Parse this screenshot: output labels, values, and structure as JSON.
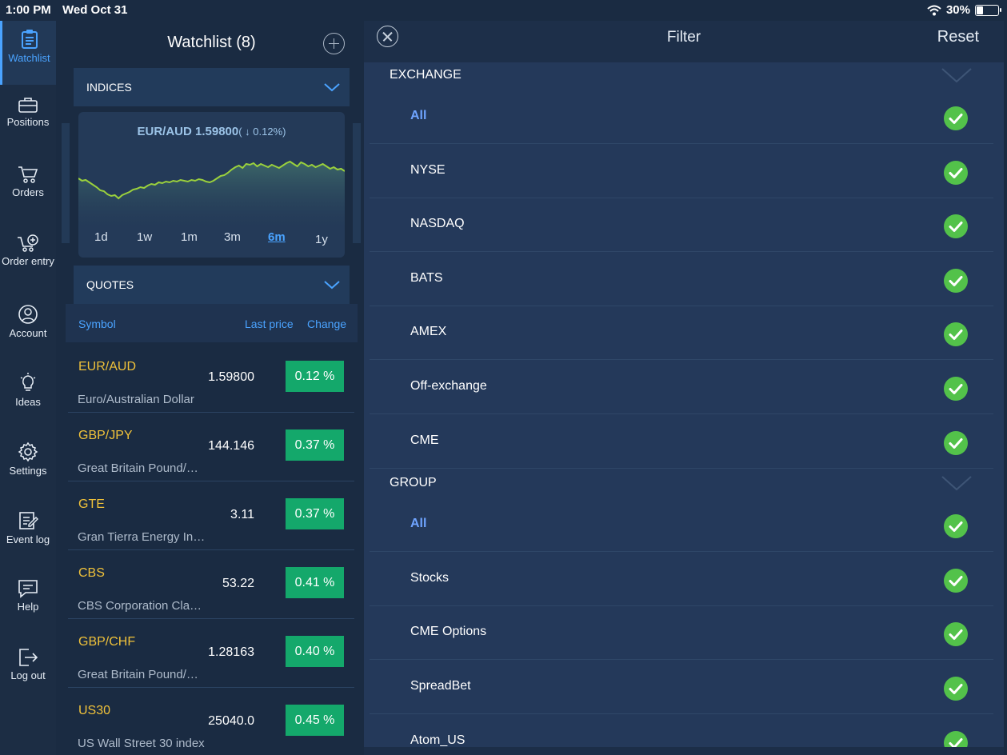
{
  "status": {
    "time": "1:00 PM",
    "date": "Wed Oct 31",
    "battery": "30%",
    "battery_level": 0.3
  },
  "sidenav": [
    {
      "label": "Watchlist",
      "icon": "clipboard-icon",
      "active": true
    },
    {
      "label": "Positions",
      "icon": "briefcase-icon"
    },
    {
      "label": "Orders",
      "icon": "cart-icon"
    },
    {
      "label": "Order entry",
      "icon": "cart-plus-icon"
    },
    {
      "label": "Account",
      "icon": "user-icon"
    },
    {
      "label": "Ideas",
      "icon": "lightbulb-icon"
    },
    {
      "label": "Settings",
      "icon": "gear-icon"
    },
    {
      "label": "Event log",
      "icon": "edit-log-icon"
    },
    {
      "label": "Help",
      "icon": "chat-icon"
    },
    {
      "label": "Log out",
      "icon": "logout-icon"
    }
  ],
  "watchlist": {
    "title": "Watchlist (8)",
    "indices_label": "INDICES",
    "quotes_label": "QUOTES",
    "chart": {
      "symbol_price": "EUR/AUD 1.59800",
      "change": "( ↓ 0.12%)",
      "ranges": [
        "1d",
        "1w",
        "1m",
        "3m",
        "6m",
        "1y"
      ],
      "selected_range": "6m",
      "line_color": "#9bd13c"
    },
    "columns": {
      "symbol": "Symbol",
      "last_price": "Last price",
      "change": "Change"
    },
    "rows": [
      {
        "symbol": "EUR/AUD",
        "name": "Euro/Australian Dollar",
        "price": "1.59800",
        "change": "0.12 %"
      },
      {
        "symbol": "GBP/JPY",
        "name": "Great Britain Pound/…",
        "price": "144.146",
        "change": "0.37 %"
      },
      {
        "symbol": "GTE",
        "name": "Gran Tierra Energy In…",
        "price": "3.11",
        "change": "0.37 %"
      },
      {
        "symbol": "CBS",
        "name": "CBS Corporation Cla…",
        "price": "53.22",
        "change": "0.41 %"
      },
      {
        "symbol": "GBP/CHF",
        "name": "Great Britain Pound/…",
        "price": "1.28163",
        "change": "0.40 %"
      },
      {
        "symbol": "US30",
        "name": "US Wall Street 30 index",
        "price": "25040.0",
        "change": "0.45 %"
      }
    ]
  },
  "filter": {
    "title": "Filter",
    "reset": "Reset",
    "exchange": {
      "label": "EXCHANGE",
      "items": [
        "All",
        "NYSE",
        "NASDAQ",
        "BATS",
        "AMEX",
        "Off-exchange",
        "CME"
      ]
    },
    "group": {
      "label": "GROUP",
      "items": [
        "All",
        "Stocks",
        "CME Options",
        "SpreadBet",
        "Atom_US"
      ]
    }
  }
}
